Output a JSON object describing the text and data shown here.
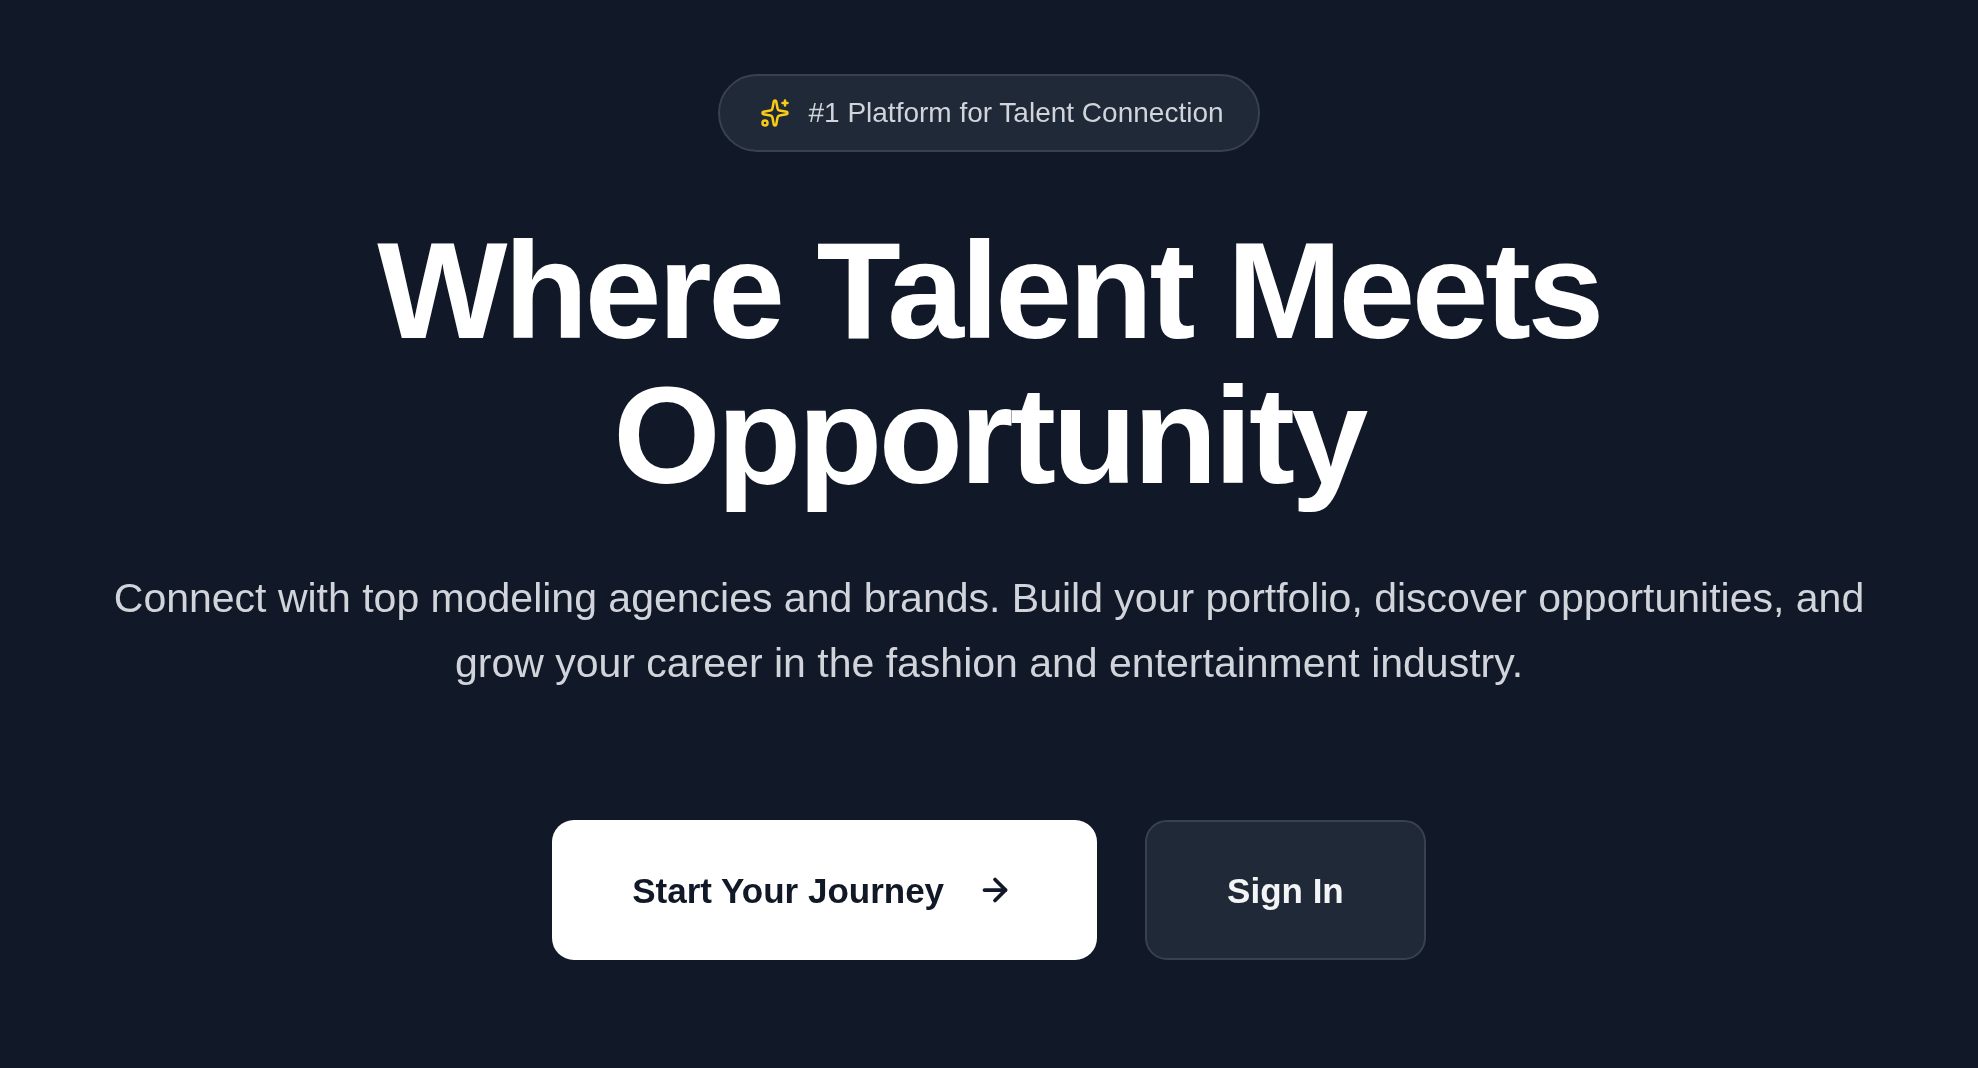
{
  "badge": {
    "text": "#1 Platform for Talent Connection"
  },
  "hero": {
    "title": "Where Talent Meets Opportunity",
    "subtitle": "Connect with top modeling agencies and brands. Build your portfolio, discover opportunities, and grow your career in the fashion and entertainment industry."
  },
  "buttons": [
    {
      "label": "Start Your Journey",
      "kind": "primary"
    },
    {
      "label": "Sign In",
      "kind": "secondary"
    }
  ]
}
